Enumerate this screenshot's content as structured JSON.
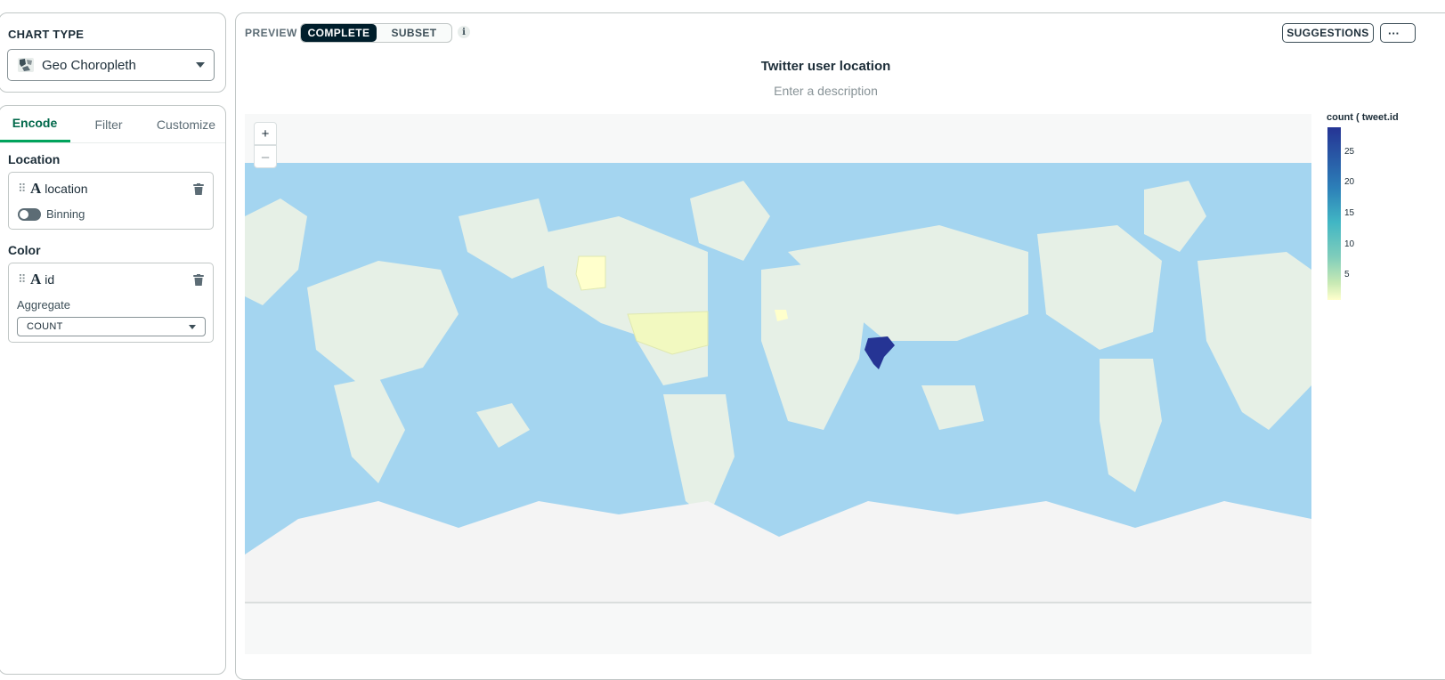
{
  "sidebar": {
    "chart_type_title": "CHART TYPE",
    "chart_type_value": "Geo Choropleth",
    "tabs": [
      {
        "label": "Encode"
      },
      {
        "label": "Filter"
      },
      {
        "label": "Customize"
      }
    ],
    "location": {
      "title": "Location",
      "field": "location",
      "binning_label": "Binning"
    },
    "color": {
      "title": "Color",
      "field": "id",
      "aggregate_label": "Aggregate",
      "aggregate_value": "COUNT"
    }
  },
  "preview": {
    "label": "PREVIEW",
    "modes": [
      {
        "label": "COMPLETE"
      },
      {
        "label": "SUBSET"
      }
    ],
    "info_glyph": "i",
    "suggestions_label": "SUGGESTIONS",
    "more_label": "···",
    "title": "Twitter user location",
    "description_placeholder": "Enter a description",
    "zoom_in": "+",
    "zoom_out": "–"
  },
  "chart_data": {
    "type": "choropleth",
    "legend_title": "count ( tweet.id",
    "legend_ticks": [
      25,
      20,
      15,
      10,
      5
    ],
    "color_range": [
      1,
      28
    ],
    "colors": {
      "high": "#253494",
      "low": "#ffffcc",
      "ocean": "#a4d5f0",
      "land": "#e6f0e6",
      "ice": "#f4f4f4"
    },
    "regions": [
      {
        "name": "India",
        "value": 28
      },
      {
        "name": "United States",
        "value": 1
      },
      {
        "name": "Alaska",
        "value": 1
      },
      {
        "name": "Europe",
        "value": 1
      }
    ]
  }
}
